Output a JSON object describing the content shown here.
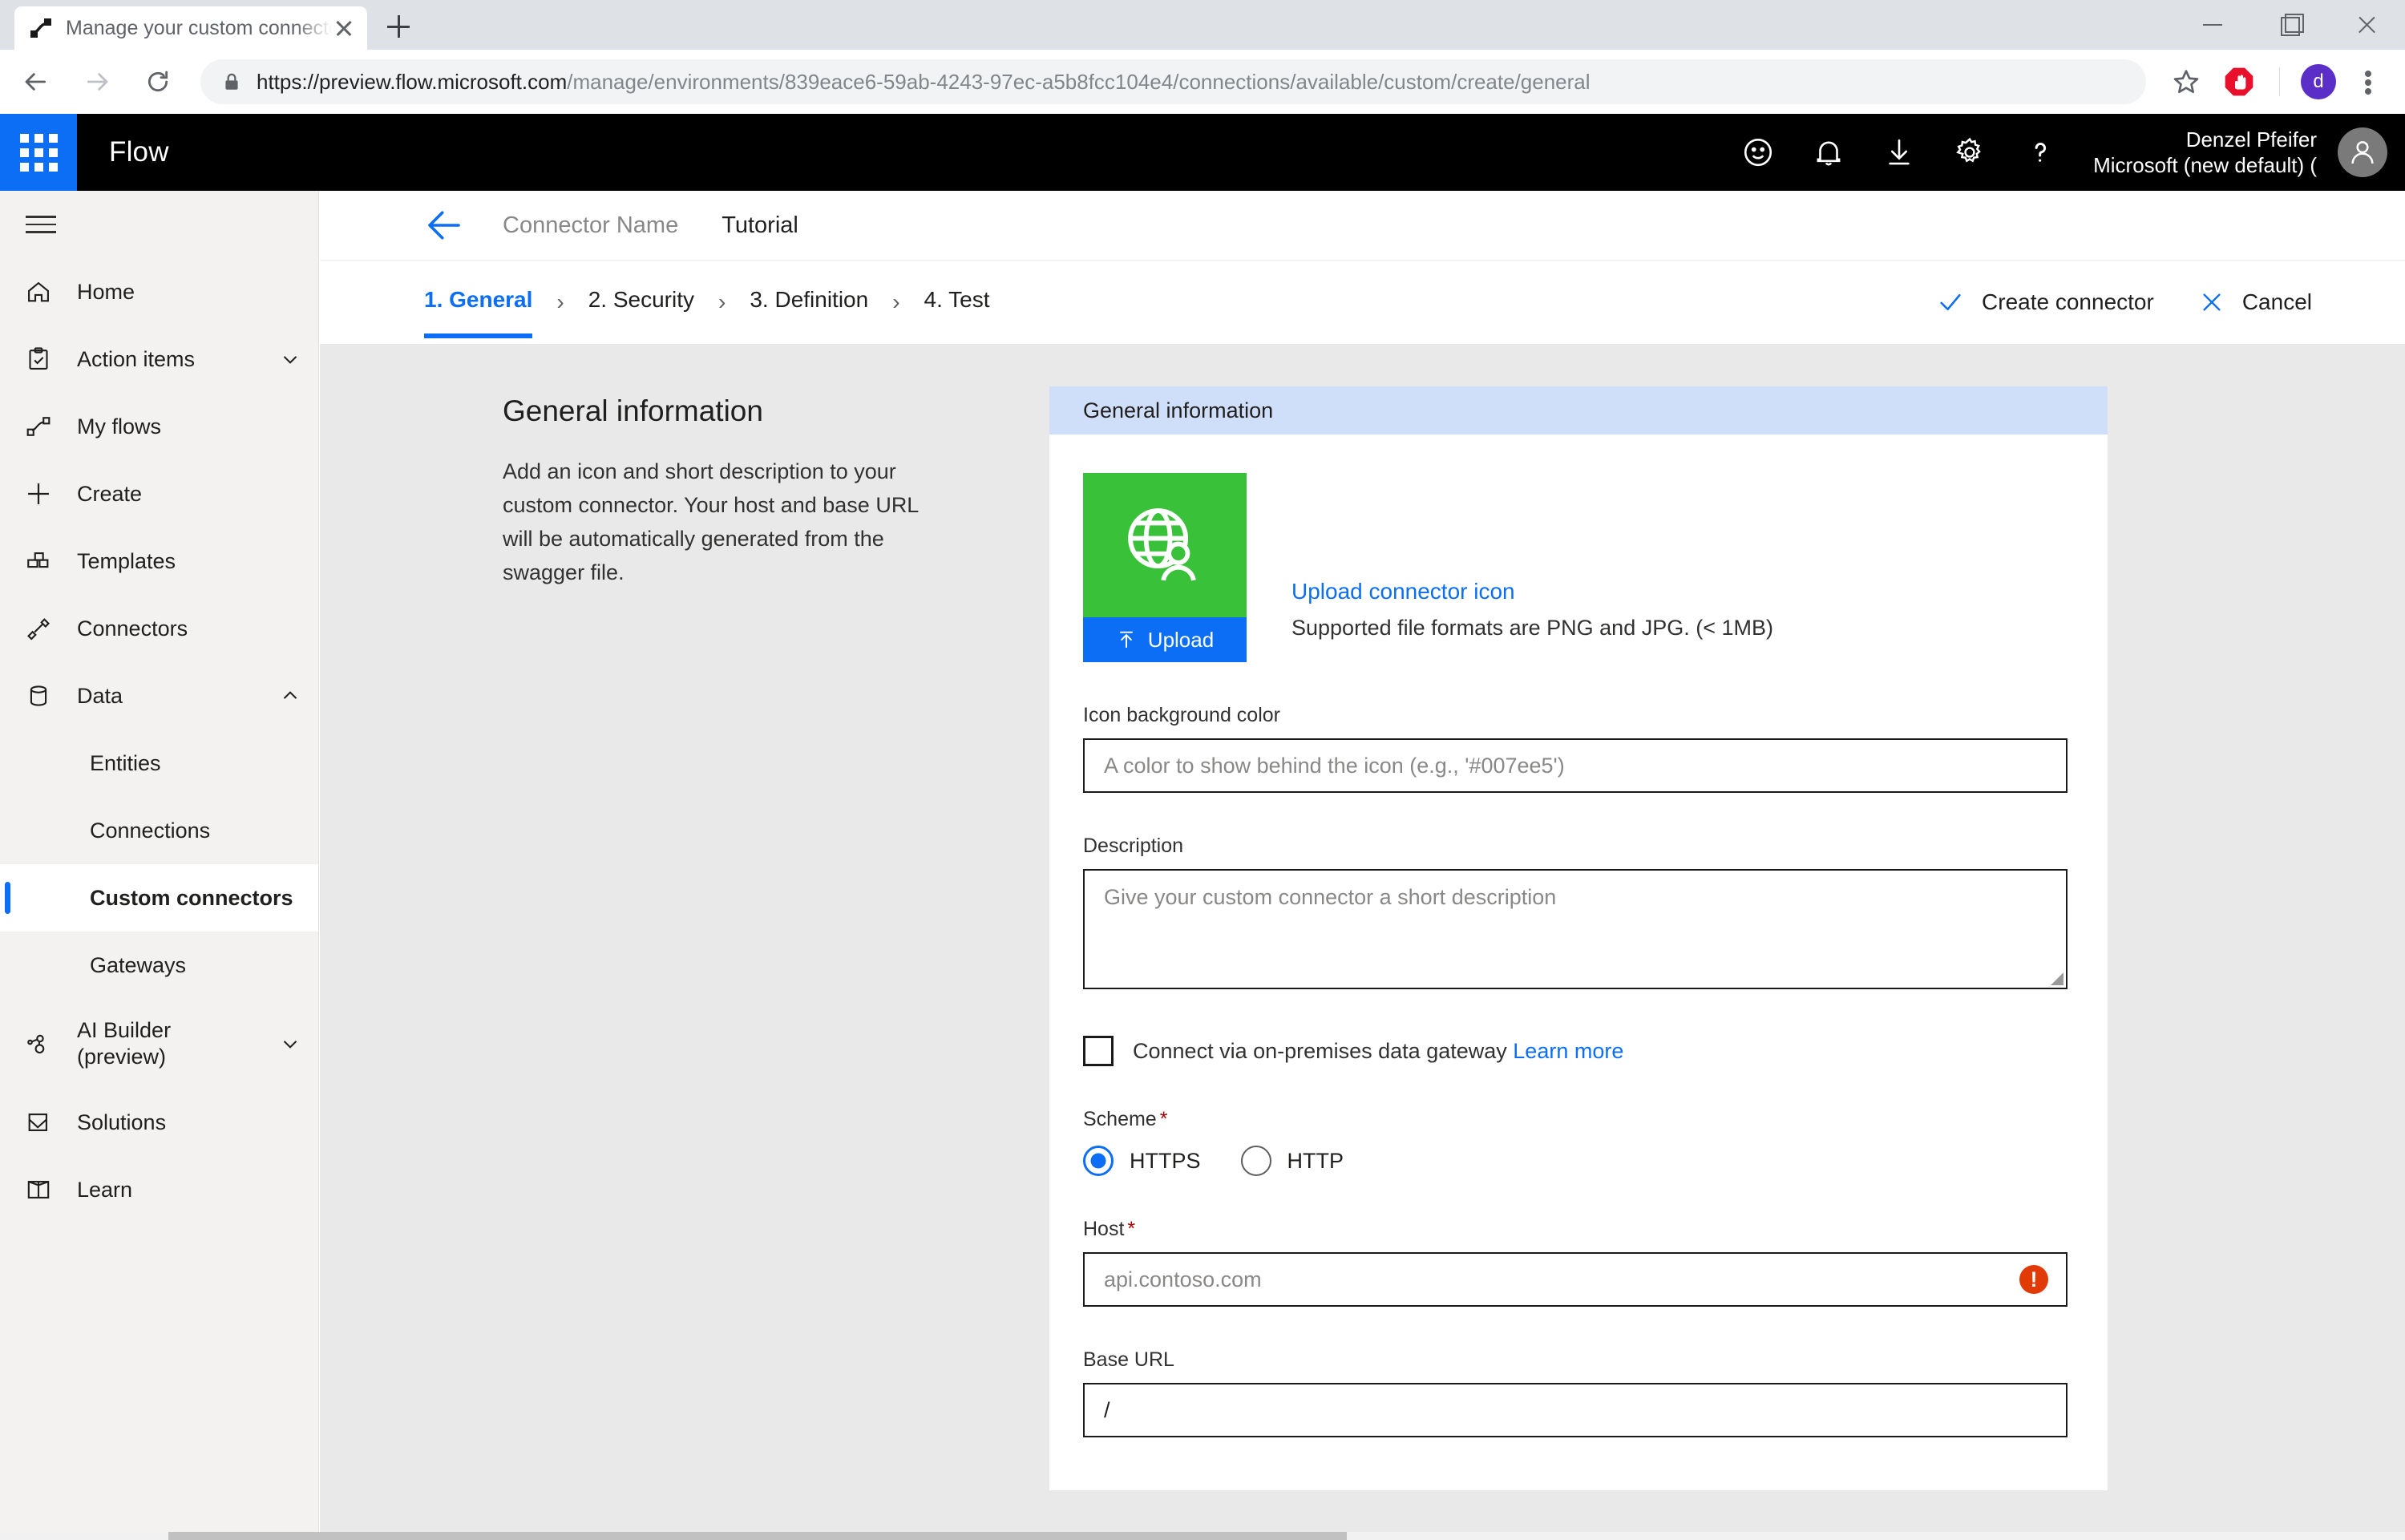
{
  "browser": {
    "tab": {
      "title": "Manage your custom connectors",
      "favicon_name": "flow-favicon",
      "close_label": "×"
    },
    "new_tab_label": "+",
    "window_controls": {
      "minimize": "–",
      "maximize": "□",
      "close": "×"
    },
    "nav": {
      "back": "back-arrow",
      "forward": "forward-arrow",
      "reload": "reload-icon"
    },
    "address": {
      "lock_icon": "lock-icon",
      "scheme_host": "https://preview.flow.microsoft.com",
      "path": "/manage/environments/839eace6-59ab-4243-97ec-a5b8fcc104e4/connections/available/custom/create/general",
      "full_url": "https://preview.flow.microsoft.com/manage/environments/839eace6-59ab-4243-97ec-a5b8fcc104e4/connections/available/custom/create/general"
    },
    "toolbar_icons": [
      "star-icon",
      "adblock-icon",
      "profile-avatar",
      "kebab-menu-icon"
    ],
    "profile_initial": "d"
  },
  "suite": {
    "waffle_label": "app-launcher-icon",
    "brand": "Flow",
    "icons": [
      "smiley-icon",
      "bell-icon",
      "download-icon",
      "gear-icon",
      "help-icon"
    ],
    "user_name": "Denzel Pfeifer",
    "user_org": "Microsoft (new default) ("
  },
  "sidebar": {
    "hamburger": "hamburger-icon",
    "items": [
      {
        "label": "Home",
        "icon": "home-icon",
        "expandable": false
      },
      {
        "label": "Action items",
        "icon": "clipboard-check-icon",
        "expandable": true,
        "chevron": "down"
      },
      {
        "label": "My flows",
        "icon": "flow-icon",
        "expandable": false
      },
      {
        "label": "Create",
        "icon": "plus-icon",
        "expandable": false
      },
      {
        "label": "Templates",
        "icon": "templates-icon",
        "expandable": false
      },
      {
        "label": "Connectors",
        "icon": "connectors-icon",
        "expandable": false
      },
      {
        "label": "Data",
        "icon": "database-icon",
        "expandable": true,
        "chevron": "up"
      }
    ],
    "data_children": [
      {
        "label": "Entities",
        "active": false
      },
      {
        "label": "Connections",
        "active": false
      },
      {
        "label": "Custom connectors",
        "active": true
      },
      {
        "label": "Gateways",
        "active": false
      }
    ],
    "items_after": [
      {
        "label": "AI Builder (preview)",
        "icon": "ai-builder-icon",
        "expandable": true,
        "chevron": "down"
      },
      {
        "label": "Solutions",
        "icon": "solutions-icon",
        "expandable": false
      },
      {
        "label": "Learn",
        "icon": "learn-icon",
        "expandable": false
      }
    ]
  },
  "breadcrumb": {
    "back_icon": "back-arrow-icon",
    "connector_name": "Connector Name",
    "current": "Tutorial"
  },
  "wizard": {
    "steps": [
      {
        "label": "1. General",
        "active": true
      },
      {
        "label": "2. Security",
        "active": false
      },
      {
        "label": "3. Definition",
        "active": false
      },
      {
        "label": "4. Test",
        "active": false
      }
    ],
    "separator": "›",
    "actions": [
      {
        "label": "Create connector",
        "icon": "check-icon"
      },
      {
        "label": "Cancel",
        "icon": "close-x-icon"
      }
    ]
  },
  "info_panel": {
    "title": "General information",
    "body": "Add an icon and short description to your custom connector. Your host and base URL will be automatically generated from the swagger file."
  },
  "form": {
    "card_title": "General information",
    "icon": {
      "tile_color": "#3ac13a",
      "glyph": "globe-person-icon",
      "upload_button": "Upload",
      "upload_icon": "upload-arrow-icon",
      "link": "Upload connector icon",
      "hint": "Supported file formats are PNG and JPG. (< 1MB)"
    },
    "icon_bg_color": {
      "label": "Icon background color",
      "value": "",
      "placeholder": "A color to show behind the icon (e.g., '#007ee5')"
    },
    "description": {
      "label": "Description",
      "value": "",
      "placeholder": "Give your custom connector a short description"
    },
    "gateway": {
      "checked": false,
      "label": "Connect via on-premises data gateway",
      "link": "Learn more"
    },
    "scheme": {
      "label": "Scheme",
      "required": "*",
      "options": [
        {
          "label": "HTTPS",
          "selected": true
        },
        {
          "label": "HTTP",
          "selected": false
        }
      ]
    },
    "host": {
      "label": "Host",
      "required": "*",
      "value": "",
      "placeholder": "api.contoso.com",
      "error_icon": "!",
      "has_error": true
    },
    "base_url": {
      "label": "Base URL",
      "value": "/",
      "placeholder": "/"
    }
  },
  "colors": {
    "accent_blue": "#0b6ef5",
    "card_header_blue": "#cfdffa",
    "icon_green": "#3ac13a",
    "error_red": "#e23a05",
    "required_red": "#a80000",
    "suite_black": "#000000"
  }
}
